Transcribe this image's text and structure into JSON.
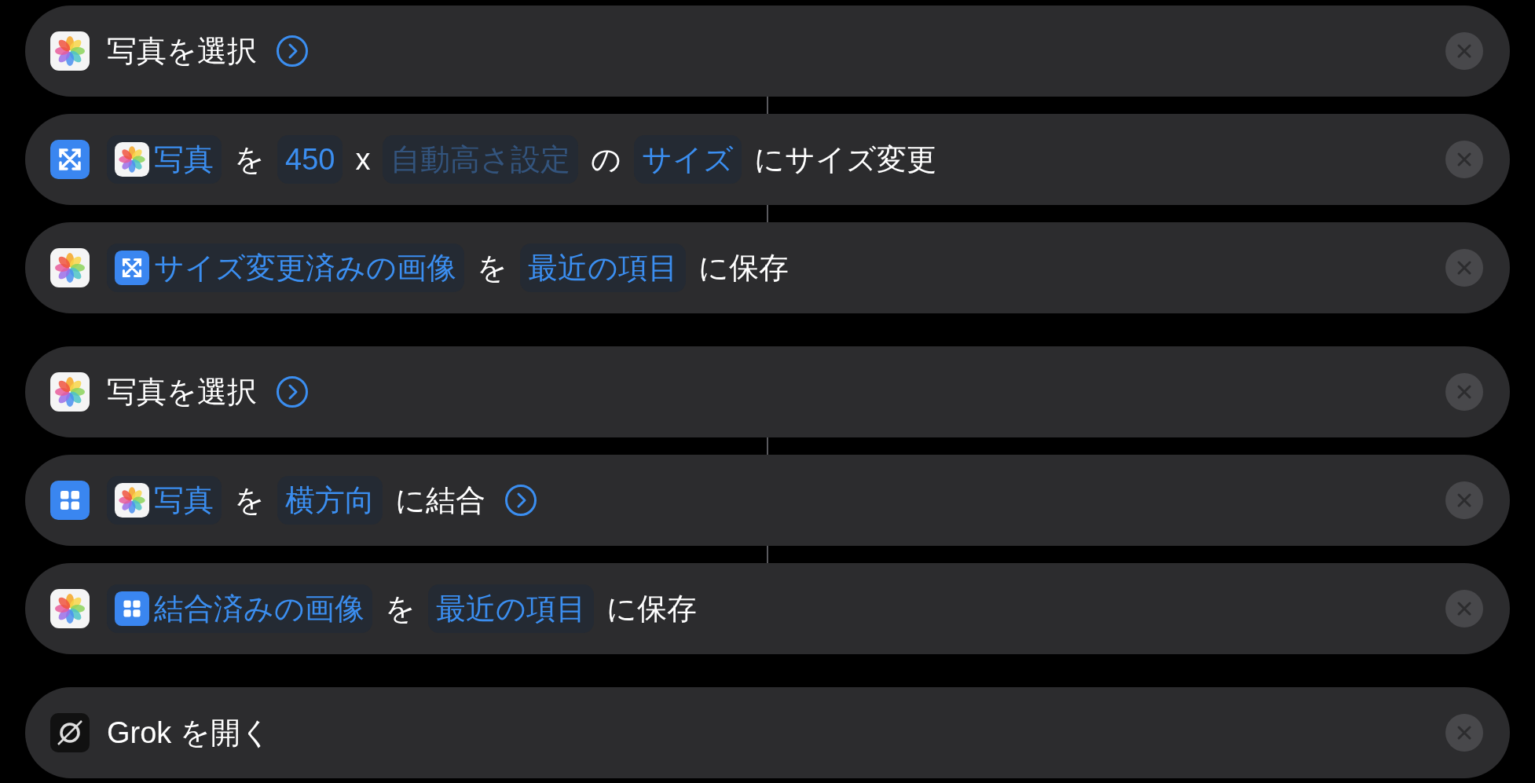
{
  "groups": [
    {
      "actions": [
        {
          "kind": "photos",
          "parts": [
            {
              "kind": "text",
              "text": "写真を選択"
            },
            {
              "kind": "chevron"
            }
          ]
        },
        {
          "kind": "resize",
          "parts": [
            {
              "kind": "photo_token",
              "text": "写真",
              "dimmed": false
            },
            {
              "kind": "text",
              "text": "を"
            },
            {
              "kind": "token",
              "text": "450",
              "dimmed": false
            },
            {
              "kind": "text",
              "text": "x"
            },
            {
              "kind": "token",
              "text": "自動高さ設定",
              "dimmed": true
            },
            {
              "kind": "text",
              "text": "の"
            },
            {
              "kind": "token",
              "text": "サイズ",
              "dimmed": false
            },
            {
              "kind": "text",
              "text": "にサイズ変更"
            }
          ]
        },
        {
          "kind": "photos",
          "parts": [
            {
              "kind": "resize_token",
              "text": "サイズ変更済みの画像",
              "dimmed": false
            },
            {
              "kind": "text",
              "text": "を"
            },
            {
              "kind": "token",
              "text": "最近の項目",
              "dimmed": false
            },
            {
              "kind": "text",
              "text": "に保存"
            }
          ]
        }
      ]
    },
    {
      "actions": [
        {
          "kind": "photos",
          "parts": [
            {
              "kind": "text",
              "text": "写真を選択"
            },
            {
              "kind": "chevron"
            }
          ]
        },
        {
          "kind": "combine",
          "parts": [
            {
              "kind": "photo_token",
              "text": "写真",
              "dimmed": false
            },
            {
              "kind": "text",
              "text": "を"
            },
            {
              "kind": "token",
              "text": "横方向",
              "dimmed": false
            },
            {
              "kind": "text",
              "text": "に結合"
            },
            {
              "kind": "chevron"
            }
          ]
        },
        {
          "kind": "photos",
          "parts": [
            {
              "kind": "combine_token",
              "text": "結合済みの画像",
              "dimmed": false
            },
            {
              "kind": "text",
              "text": "を"
            },
            {
              "kind": "token",
              "text": "最近の項目",
              "dimmed": false
            },
            {
              "kind": "text",
              "text": "に保存"
            }
          ]
        }
      ]
    },
    {
      "actions": [
        {
          "kind": "app",
          "parts": [
            {
              "kind": "text",
              "text": "Grok を開く"
            }
          ]
        }
      ]
    }
  ]
}
